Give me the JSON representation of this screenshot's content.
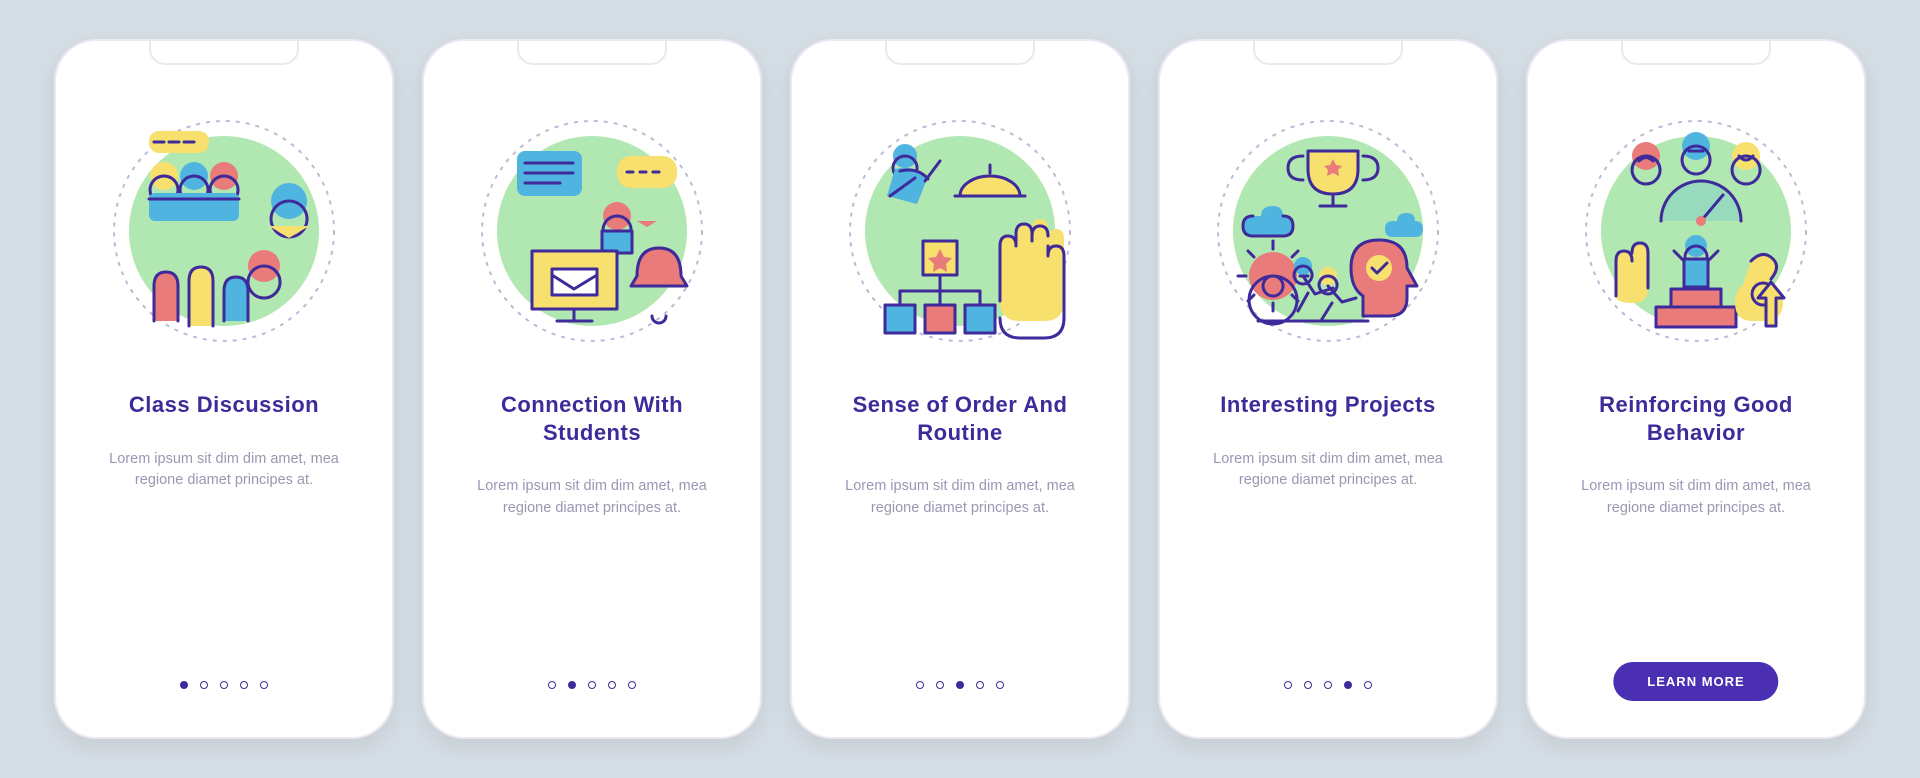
{
  "placeholder": "Lorem ipsum sit dim dim amet, mea regione diamet principes at.",
  "cta_label": "LEARN MORE",
  "slides": [
    {
      "title": "Class Discussion",
      "icon": "class-discussion"
    },
    {
      "title": "Connection With Students",
      "icon": "connection"
    },
    {
      "title": "Sense of Order And Routine",
      "icon": "order-routine"
    },
    {
      "title": "Interesting Projects",
      "icon": "projects"
    },
    {
      "title": "Reinforcing Good Behavior",
      "icon": "good-behavior"
    }
  ],
  "colors": {
    "primary": "#3e2a9a",
    "accent_blue": "#4fb5e0",
    "accent_yellow": "#f7e06e",
    "accent_coral": "#e97b7b",
    "accent_green": "#a3e3a3",
    "bg": "#d5dde5"
  }
}
